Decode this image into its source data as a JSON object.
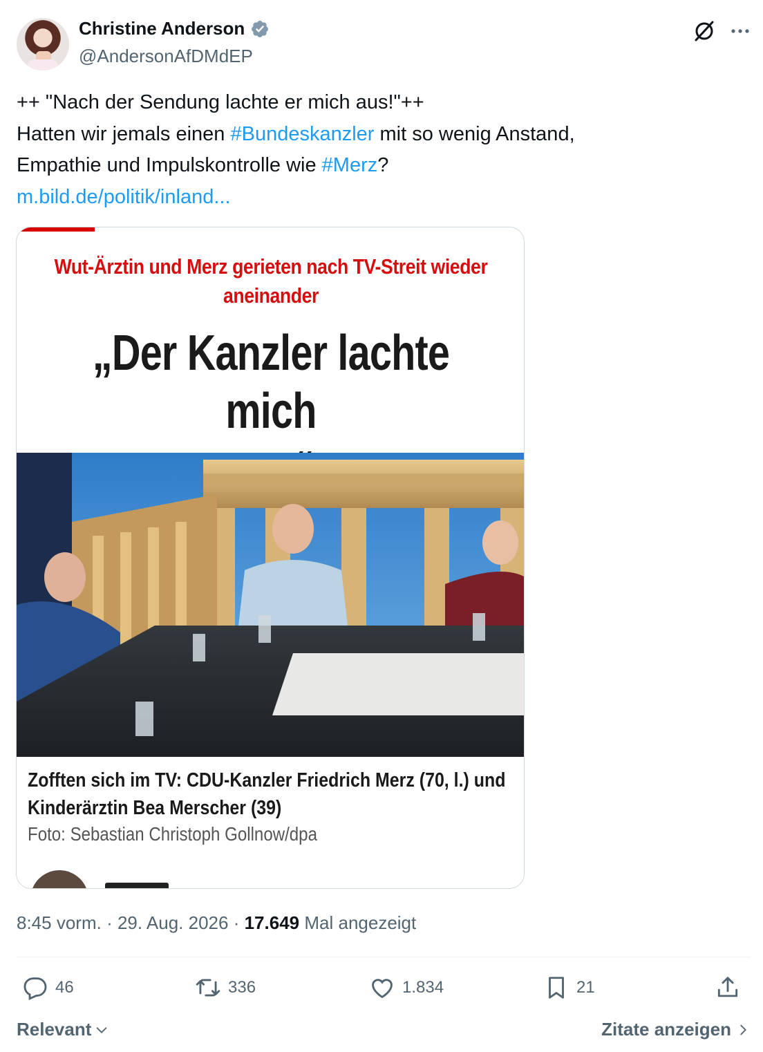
{
  "author": {
    "name": "Christine Anderson",
    "handle": "@AndersonAfDMdEP",
    "verified": true
  },
  "tweet": {
    "line1": "++ \"Nach der Sendung lachte er mich aus!\"++",
    "line2_pre": "Hatten wir jemals einen ",
    "line2_tag": "#Bundeskanzler",
    "line2_post": " mit so wenig Anstand,",
    "line3_pre": "Empathie und Impulskontrolle wie ",
    "line3_tag": "#Merz",
    "line3_post": "?",
    "link": "m.bild.de/politik/inland..."
  },
  "card": {
    "kicker_line1": "Wut-Ärztin und Merz gerieten nach TV-Streit wieder",
    "kicker_line2": "aneinander",
    "headline_line1": "„Der Kanzler lachte mich",
    "headline_line2": "aus“",
    "caption_line1": "Zofften sich im TV: CDU-Kanzler Friedrich Merz (70, l.) und",
    "caption_line2": "Kinderärztin Bea Merscher (39)",
    "credit": "Foto: Sebastian Christoph Gollnow/dpa"
  },
  "meta": {
    "time": "8:45 vorm.",
    "date": "29. Aug. 2026",
    "views": "17.649",
    "views_label": "Mal angezeigt",
    "separator": "·"
  },
  "actions": {
    "replies": "46",
    "reposts": "336",
    "likes": "1.834",
    "bookmarks": "21"
  },
  "footer": {
    "sort_label": "Relevant",
    "quotes_label": "Zitate anzeigen"
  },
  "colors": {
    "link": "#1d9bf0",
    "secondary_text": "#536471",
    "verified": "#829aab",
    "bild_red": "#d50f0f"
  },
  "icons": [
    "verified-badge-icon",
    "grok-icon",
    "more-icon",
    "reply-icon",
    "retweet-icon",
    "like-icon",
    "bookmark-icon",
    "share-icon",
    "chevron-down-icon",
    "chevron-right-icon"
  ]
}
